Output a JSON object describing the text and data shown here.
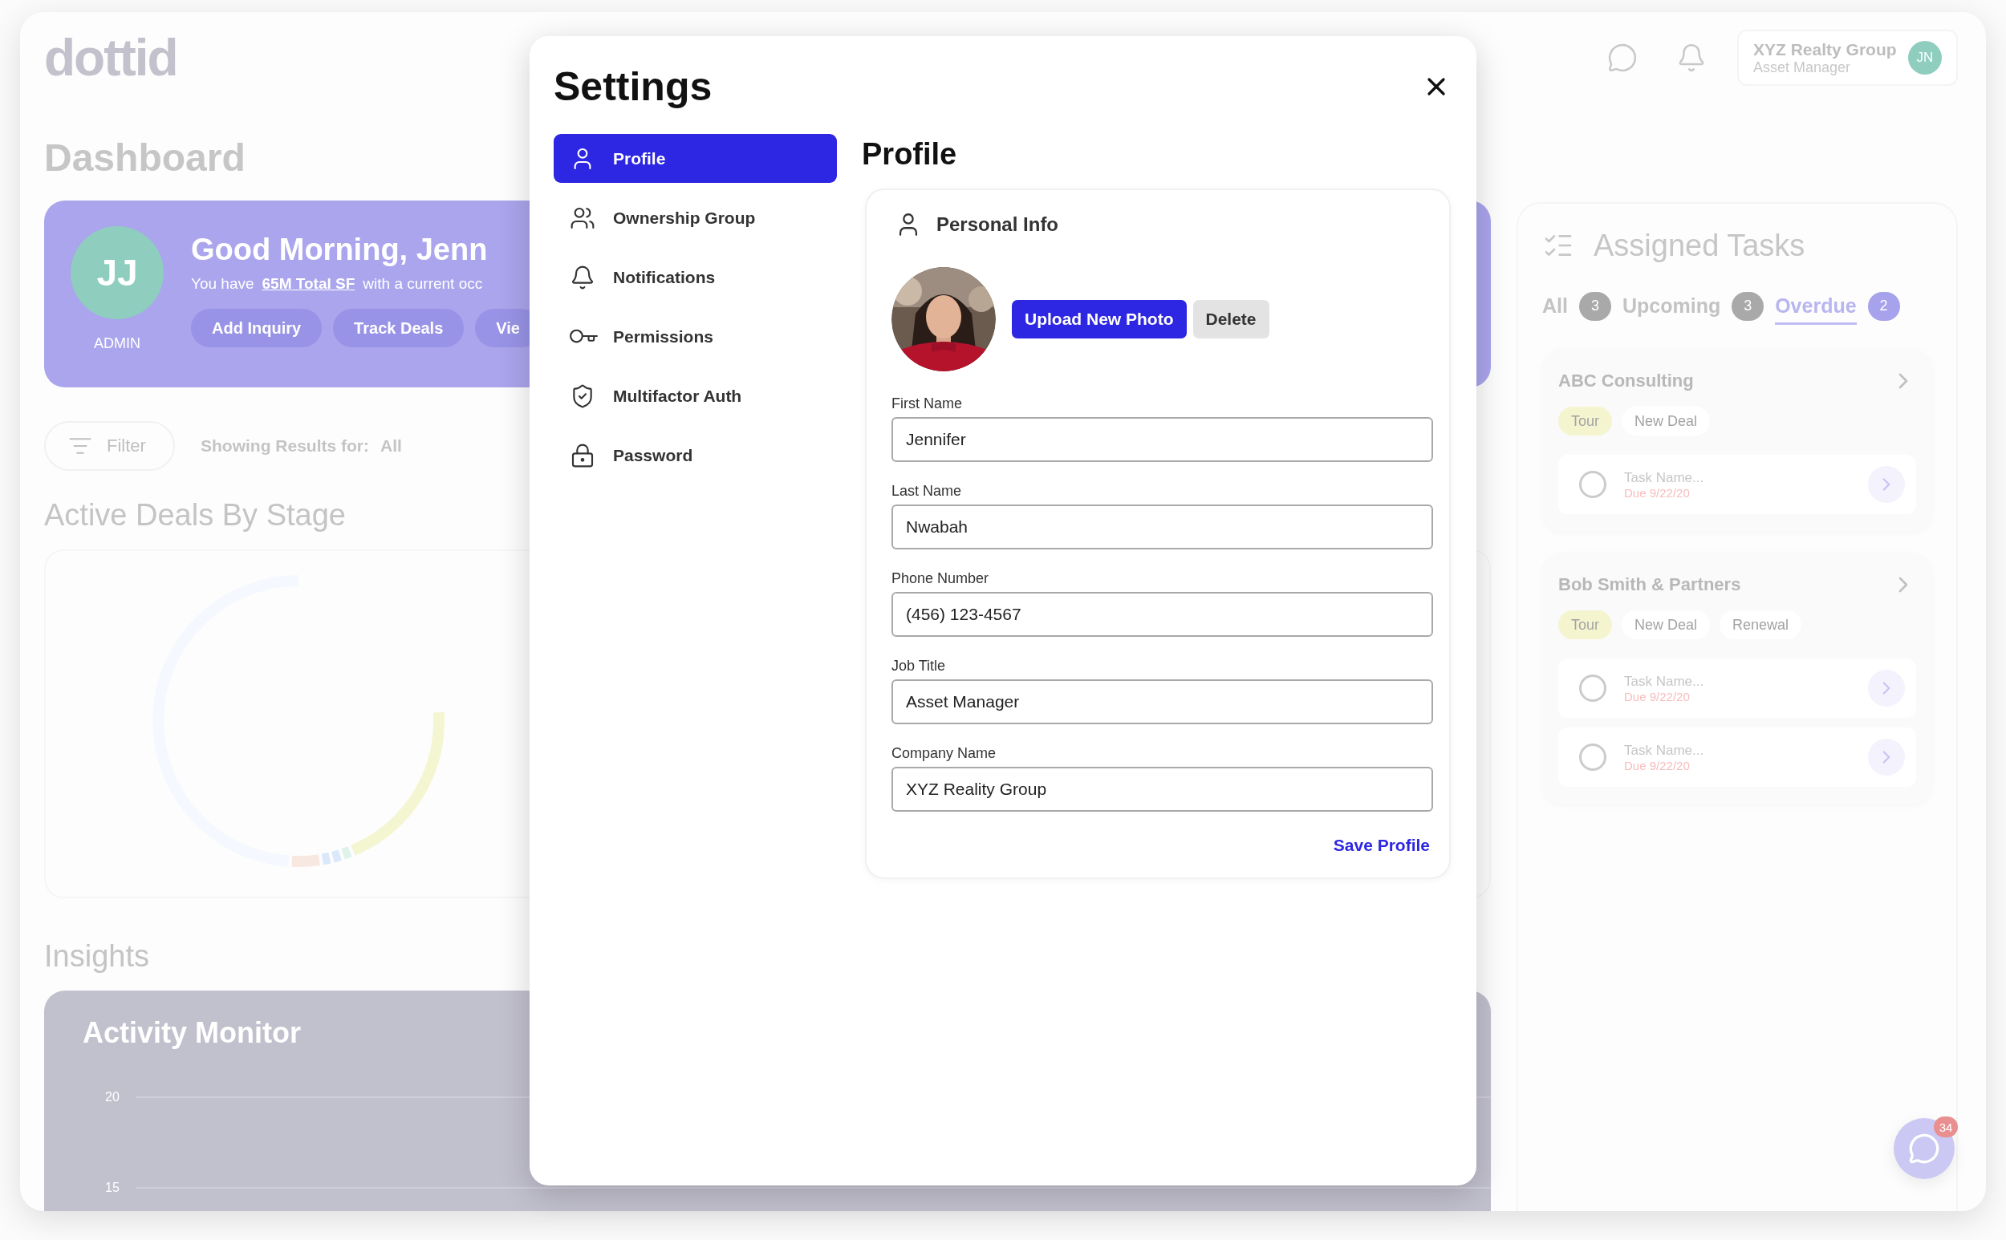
{
  "app": {
    "logo": "dottid"
  },
  "header": {
    "company": "XYZ Realty Group",
    "role": "Asset Manager",
    "initials": "JN"
  },
  "dashboard": {
    "title": "Dashboard",
    "banner": {
      "initials": "JJ",
      "role": "ADMIN",
      "greeting": "Good Morning, Jenn",
      "summary": {
        "before": "You have",
        "link": "65M Total SF",
        "after": "with a current occ"
      },
      "actions": [
        "Add Inquiry",
        "Track Deals",
        "Vie"
      ]
    },
    "filter": {
      "label": "Filter",
      "showing_label": "Showing Results for:",
      "showing_value": "All"
    },
    "deals_title": "Active Deals By Stage",
    "insights_title": "Insights",
    "activity": {
      "title": "Activity Monitor",
      "y_ticks": [
        "20",
        "15"
      ]
    }
  },
  "tasks": {
    "title": "Assigned Tasks",
    "tabs": [
      {
        "label": "All",
        "count": "3",
        "selected": false
      },
      {
        "label": "Upcoming",
        "count": "3",
        "selected": false
      },
      {
        "label": "Overdue",
        "count": "2",
        "selected": true
      }
    ],
    "groups": [
      {
        "name": "ABC Consulting",
        "tags": [
          {
            "label": "Tour",
            "color": "#f4f5cf"
          },
          {
            "label": "New Deal",
            "color": "#ffffff"
          }
        ],
        "items": [
          {
            "name": "Task Name...",
            "due": "Due 9/22/20",
            "checked": false
          }
        ]
      },
      {
        "name": "Bob Smith & Partners",
        "tags": [
          {
            "label": "Tour",
            "color": "#f4f5cf"
          },
          {
            "label": "New Deal",
            "color": "#ffffff"
          },
          {
            "label": "Renewal",
            "color": "#ffffff"
          }
        ],
        "items": [
          {
            "name": "Task Name...",
            "due": "Due 9/22/20",
            "checked": false
          },
          {
            "name": "Task Name...",
            "due": "Due 9/22/20",
            "checked": false
          }
        ]
      }
    ]
  },
  "chat": {
    "badge": "34"
  },
  "settings": {
    "title": "Settings",
    "nav": [
      {
        "label": "Profile",
        "kind": "user",
        "selected": true
      },
      {
        "label": "Ownership Group",
        "kind": "users",
        "selected": false
      },
      {
        "label": "Notifications",
        "kind": "bell",
        "selected": false
      },
      {
        "label": "Permissions",
        "kind": "key",
        "selected": false
      },
      {
        "label": "Multifactor Auth",
        "kind": "shield",
        "selected": false
      },
      {
        "label": "Password",
        "kind": "lock",
        "selected": false
      }
    ],
    "heading": "Profile",
    "section": "Personal Info",
    "upload": "Upload New Photo",
    "delete": "Delete",
    "fields": [
      {
        "label": "First Name",
        "value": "Jennifer"
      },
      {
        "label": "Last Name",
        "value": "Nwabah"
      },
      {
        "label": "Phone Number",
        "value": "(456) 123-4567"
      },
      {
        "label": "Job Title",
        "value": "Asset Manager"
      },
      {
        "label": "Company Name",
        "value": "XYZ Reality Group"
      }
    ],
    "save": "Save Profile"
  }
}
